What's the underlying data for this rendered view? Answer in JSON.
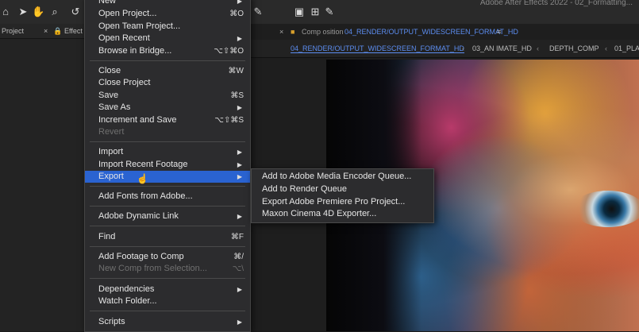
{
  "app_title": "Adobe After Effects 2022 - 02_Formatting...",
  "left_panel": {
    "project_label": "Project",
    "effects_label": "Effect"
  },
  "comp_header": {
    "prefix": "Comp osition",
    "name": "04_RENDER/OUTPUT_WIDESCREEN_FORMAT_HD",
    "menu_glyph": "≡"
  },
  "comp_tabs": [
    {
      "label": "04_RENDER/OUTPUT_WIDESCREEN_FORMAT_HD"
    },
    {
      "label": "03_AN IMATE_HD"
    },
    {
      "label": "DEPTH_COMP"
    },
    {
      "label": "01_PLA"
    }
  ],
  "file_menu": [
    {
      "label": "New",
      "shortcut": "",
      "submenu": true
    },
    {
      "label": "Open Project...",
      "shortcut": "⌘O"
    },
    {
      "label": "Open Team Project...",
      "shortcut": ""
    },
    {
      "label": "Open Recent",
      "shortcut": "",
      "submenu": true
    },
    {
      "label": "Browse in Bridge...",
      "shortcut": "⌥⇧⌘O"
    },
    {
      "label": "Close",
      "shortcut": "⌘W"
    },
    {
      "label": "Close Project",
      "shortcut": ""
    },
    {
      "label": "Save",
      "shortcut": "⌘S"
    },
    {
      "label": "Save As",
      "shortcut": "",
      "submenu": true
    },
    {
      "label": "Increment and Save",
      "shortcut": "⌥⇧⌘S"
    },
    {
      "label": "Revert",
      "shortcut": "",
      "disabled": true
    },
    {
      "label": "Import",
      "shortcut": "",
      "submenu": true
    },
    {
      "label": "Import Recent Footage",
      "shortcut": "",
      "submenu": true
    },
    {
      "label": "Export",
      "shortcut": "",
      "submenu": true,
      "highlighted": true
    },
    {
      "label": "Add Fonts from Adobe...",
      "shortcut": ""
    },
    {
      "label": "Adobe Dynamic Link",
      "shortcut": "",
      "submenu": true
    },
    {
      "label": "Find",
      "shortcut": "⌘F"
    },
    {
      "label": "Add Footage to Comp",
      "shortcut": "⌘/"
    },
    {
      "label": "New Comp from Selection...",
      "shortcut": "⌥\\",
      "disabled": true
    },
    {
      "label": "Dependencies",
      "shortcut": "",
      "submenu": true
    },
    {
      "label": "Watch Folder...",
      "shortcut": ""
    },
    {
      "label": "Scripts",
      "shortcut": "",
      "submenu": true
    }
  ],
  "export_submenu": [
    {
      "label": "Add to Adobe Media Encoder Queue..."
    },
    {
      "label": "Add to Render Queue"
    },
    {
      "label": "Export Adobe Premiere Pro Project..."
    },
    {
      "label": "Maxon Cinema 4D Exporter..."
    }
  ],
  "colors": {
    "highlight": "#2a63d1",
    "accent_tab": "#5c8df0",
    "menu_bg": "#2c2c2e"
  }
}
